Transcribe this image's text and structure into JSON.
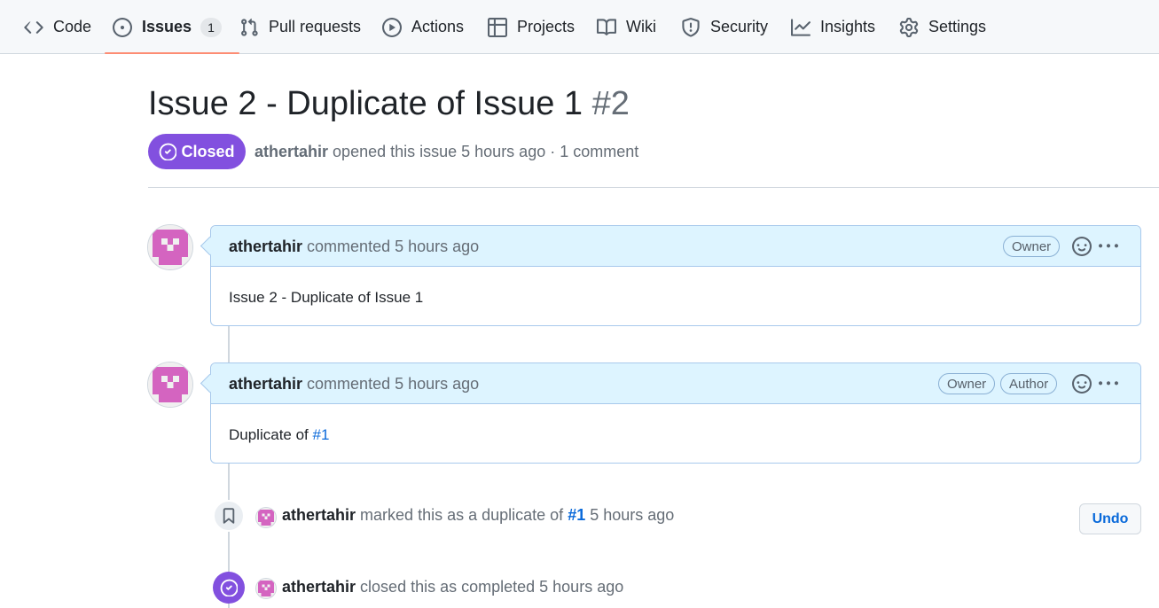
{
  "nav": {
    "items": [
      {
        "label": "Code",
        "icon": "code-icon"
      },
      {
        "label": "Issues",
        "icon": "issue-opened-icon",
        "counter": "1",
        "selected": true
      },
      {
        "label": "Pull requests",
        "icon": "git-pull-request-icon"
      },
      {
        "label": "Actions",
        "icon": "play-icon"
      },
      {
        "label": "Projects",
        "icon": "table-icon"
      },
      {
        "label": "Wiki",
        "icon": "book-icon"
      },
      {
        "label": "Security",
        "icon": "shield-icon"
      },
      {
        "label": "Insights",
        "icon": "graph-icon"
      },
      {
        "label": "Settings",
        "icon": "gear-icon"
      }
    ]
  },
  "issue": {
    "title": "Issue 2 - Duplicate of Issue 1",
    "number": "#2",
    "state": "Closed",
    "author": "athertahir",
    "meta_text": "opened this issue 5 hours ago · 1 comment"
  },
  "comments": [
    {
      "author": "athertahir",
      "action": "commented 5 hours ago",
      "labels": [
        "Owner"
      ],
      "body": "Issue 2 - Duplicate of Issue 1"
    },
    {
      "author": "athertahir",
      "action": "commented 5 hours ago",
      "labels": [
        "Owner",
        "Author"
      ],
      "body_prefix": "Duplicate of",
      "body_link": "#1"
    }
  ],
  "events": [
    {
      "author": "athertahir",
      "text_before": "marked this as a duplicate of",
      "link": "#1",
      "text_after": "5 hours ago",
      "button": "Undo",
      "icon": "bookmark-icon"
    },
    {
      "author": "athertahir",
      "text": "closed this as completed 5 hours ago",
      "icon": "issue-closed-icon"
    }
  ],
  "colors": {
    "closed_purple": "#8250df",
    "link_blue": "#0969da",
    "selected_underline": "#fd8c73",
    "comment_header_bg": "#ddf4ff"
  }
}
